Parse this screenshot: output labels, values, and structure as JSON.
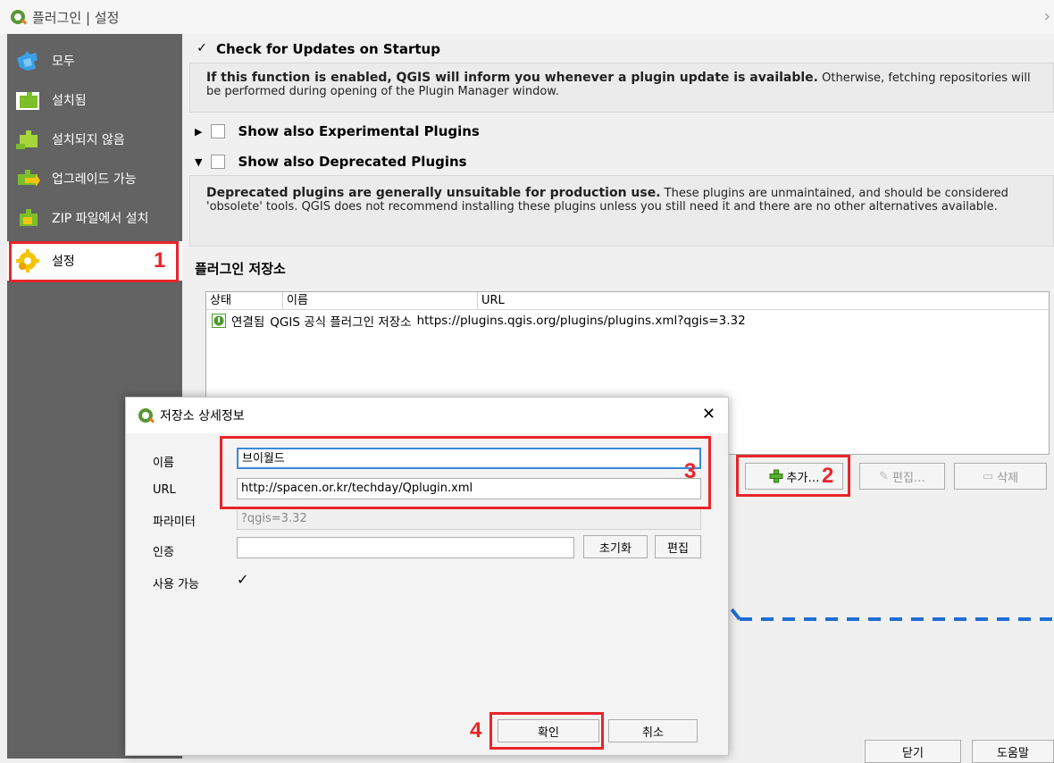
{
  "window": {
    "title": "플러그인 | 설정"
  },
  "sidebar": {
    "items": [
      {
        "label": "모두",
        "icon": "puzzle-all-icon"
      },
      {
        "label": "설치됨",
        "icon": "puzzle-installed-icon"
      },
      {
        "label": "설치되지 않음",
        "icon": "puzzle-not-installed-icon"
      },
      {
        "label": "업그레이드 가능",
        "icon": "puzzle-upgrade-icon"
      },
      {
        "label": "ZIP 파일에서 설치",
        "icon": "puzzle-zip-icon"
      },
      {
        "label": "설정",
        "icon": "gear-icon"
      }
    ],
    "selected_index": 5
  },
  "settings": {
    "check_updates_label": "Check for Updates on Startup",
    "check_updates_checked": true,
    "updates_desc_bold": "If this function is enabled, QGIS will inform you whenever a plugin update is available.",
    "updates_desc_rest": " Otherwise, fetching repositories will be performed during opening of the Plugin Manager window.",
    "experimental_label": "Show also Experimental Plugins",
    "deprecated_label": "Show also Deprecated Plugins",
    "deprecated_desc_bold": "Deprecated plugins are generally unsuitable for production use.",
    "deprecated_desc_rest": " These plugins are unmaintained, and should be considered 'obsolete' tools. QGIS does not recommend installing these plugins unless you still need it and there are no other alternatives available."
  },
  "repositories": {
    "section_title": "플러그인 저장소",
    "columns": [
      "상태",
      "이름",
      "URL"
    ],
    "rows": [
      {
        "status": "연결됨",
        "name": "QGIS 공식 플러그인 저장소",
        "url": "https://plugins.qgis.org/plugins/plugins.xml?qgis=3.32"
      }
    ],
    "add_label": "추가…",
    "edit_label": "편집…",
    "delete_label": "삭제"
  },
  "footer": {
    "close_label": "닫기",
    "help_label": "도움말"
  },
  "dialog": {
    "title": "저장소 상세정보",
    "name_label": "이름",
    "name_value": "브이월드",
    "url_label": "URL",
    "url_value": "http://spacen.or.kr/techday/Qplugin.xml",
    "param_label": "파라미터",
    "param_placeholder": "?qgis=3.32",
    "auth_label": "인증",
    "auth_value": "",
    "reset_label": "초기화",
    "auth_edit_label": "편집",
    "enabled_label": "사용 가능",
    "enabled_checked": true,
    "ok_label": "확인",
    "cancel_label": "취소"
  },
  "annotations": {
    "step1": "1",
    "step2": "2",
    "step3": "3",
    "step4": "4"
  },
  "colors": {
    "highlight": "#e8242a",
    "arrow": "#1f6ed4",
    "sidebar": "#636363",
    "qgis_green": "#589632"
  }
}
